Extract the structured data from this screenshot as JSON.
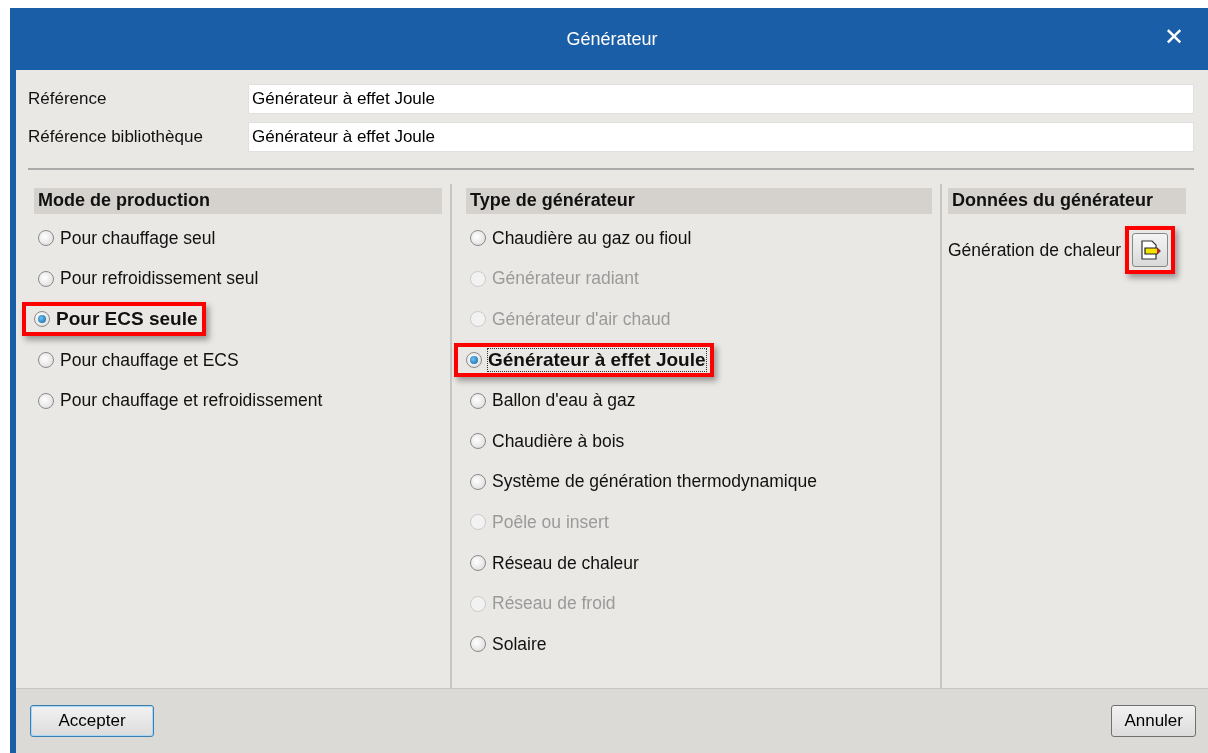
{
  "window": {
    "title": "Générateur",
    "close": "✕"
  },
  "fields": [
    {
      "label": "Référence",
      "value": "Générateur à effet Joule"
    },
    {
      "label": "Référence bibliothèque",
      "value": "Générateur à effet Joule"
    }
  ],
  "mode_de_production": {
    "title": "Mode de production",
    "options": [
      {
        "label": "Pour chauffage seul",
        "selected": false,
        "disabled": false,
        "highlighted": false
      },
      {
        "label": "Pour refroidissement seul",
        "selected": false,
        "disabled": false,
        "highlighted": false
      },
      {
        "label": "Pour ECS seule",
        "selected": true,
        "disabled": false,
        "highlighted": true
      },
      {
        "label": "Pour chauffage et ECS",
        "selected": false,
        "disabled": false,
        "highlighted": false
      },
      {
        "label": "Pour chauffage et refroidissement",
        "selected": false,
        "disabled": false,
        "highlighted": false
      }
    ]
  },
  "type_de_generateur": {
    "title": "Type de générateur",
    "options": [
      {
        "label": "Chaudière au gaz ou fioul",
        "selected": false,
        "disabled": false,
        "highlighted": false
      },
      {
        "label": "Générateur radiant",
        "selected": false,
        "disabled": true,
        "highlighted": false
      },
      {
        "label": "Générateur d'air chaud",
        "selected": false,
        "disabled": true,
        "highlighted": false
      },
      {
        "label": "Générateur à effet Joule",
        "selected": true,
        "disabled": false,
        "highlighted": true
      },
      {
        "label": "Ballon d'eau à gaz",
        "selected": false,
        "disabled": false,
        "highlighted": false
      },
      {
        "label": "Chaudière à bois",
        "selected": false,
        "disabled": false,
        "highlighted": false
      },
      {
        "label": "Système de génération thermodynamique",
        "selected": false,
        "disabled": false,
        "highlighted": false
      },
      {
        "label": "Poêle ou insert",
        "selected": false,
        "disabled": true,
        "highlighted": false
      },
      {
        "label": "Réseau de chaleur",
        "selected": false,
        "disabled": false,
        "highlighted": false
      },
      {
        "label": "Réseau de froid",
        "selected": false,
        "disabled": true,
        "highlighted": false
      },
      {
        "label": "Solaire",
        "selected": false,
        "disabled": false,
        "highlighted": false
      }
    ]
  },
  "donnees": {
    "title": "Données du générateur",
    "label": "Génération de chaleur",
    "button_highlighted": true
  },
  "buttons": {
    "accept": "Accepter",
    "cancel": "Annuler"
  }
}
